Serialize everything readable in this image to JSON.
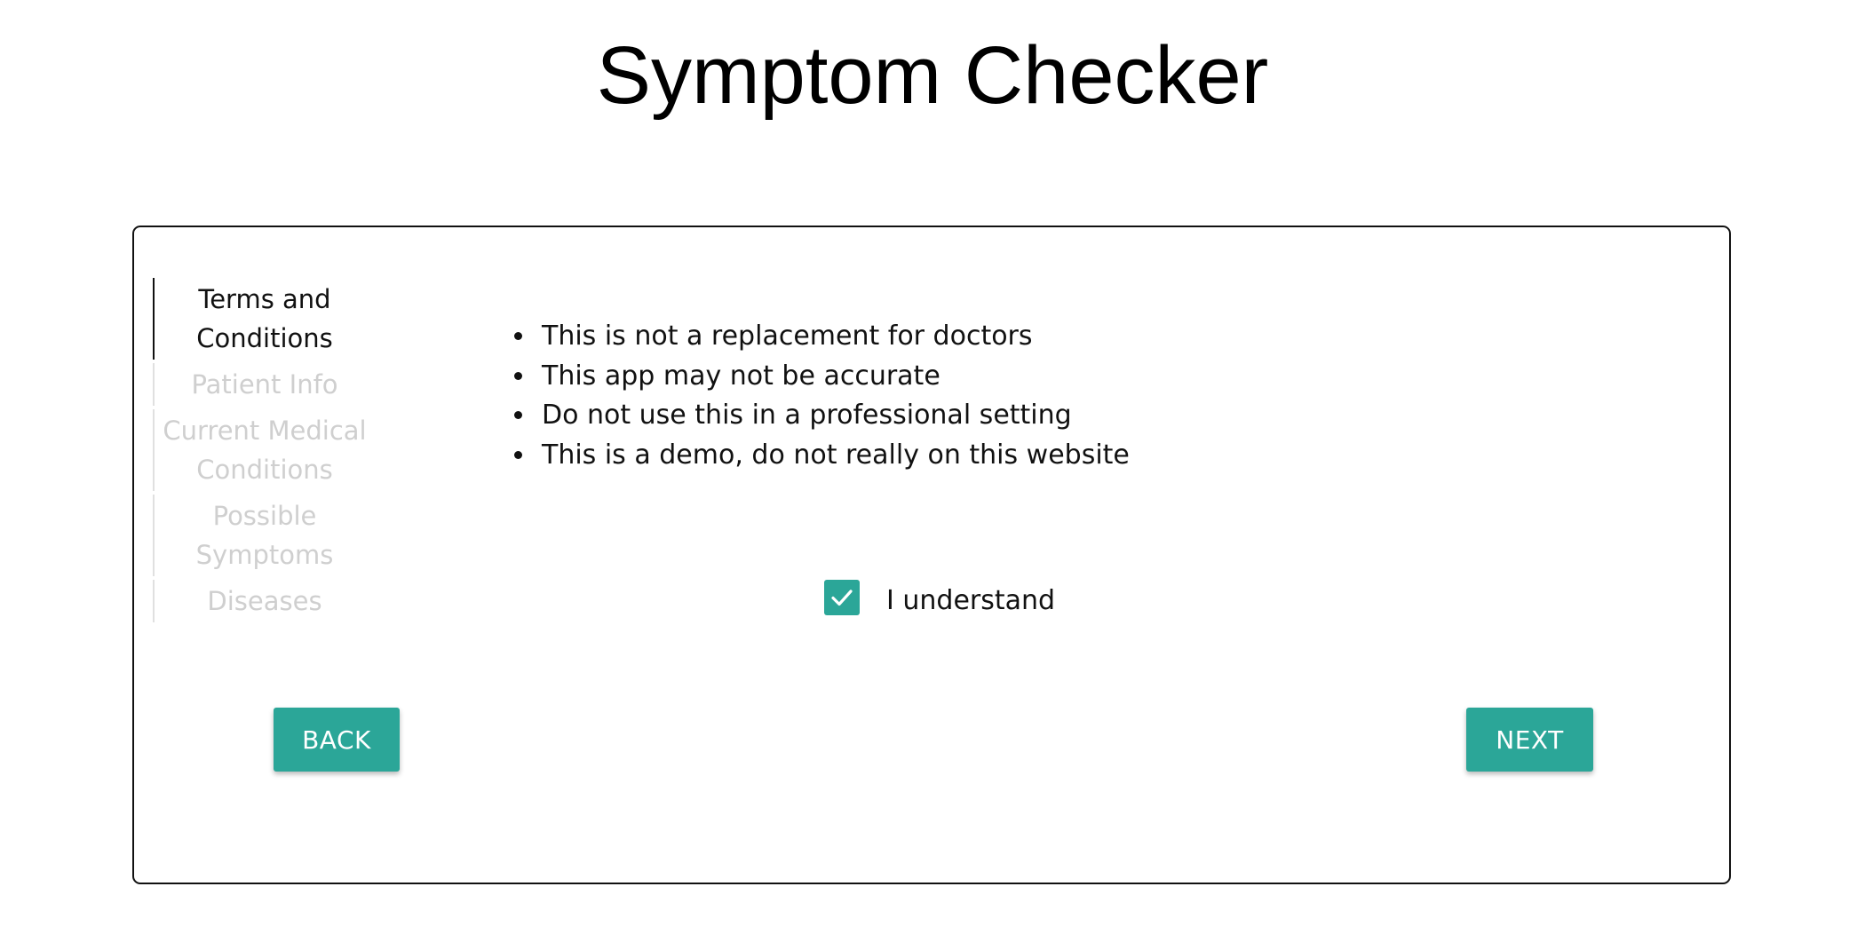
{
  "header": {
    "title": "Symptom Checker"
  },
  "stepper": {
    "steps": [
      {
        "line1": "Terms and",
        "line2": "Conditions",
        "state": "active"
      },
      {
        "line1": "Patient Info",
        "line2": "",
        "state": "inactive"
      },
      {
        "line1": "Current Medical",
        "line2": "Conditions",
        "state": "inactive"
      },
      {
        "line1": "Possible",
        "line2": "Symptoms",
        "state": "inactive"
      },
      {
        "line1": "Diseases",
        "line2": "",
        "state": "inactive"
      }
    ]
  },
  "terms": {
    "items": [
      "This is not a replacement for doctors",
      "This app may not be accurate",
      "Do not use this in a professional setting",
      "This is a demo, do not really on this website"
    ]
  },
  "acknowledge": {
    "label": "I understand",
    "checked": true,
    "icon": "check-icon"
  },
  "buttons": {
    "back_label": "BACK",
    "next_label": "NEXT"
  },
  "colors": {
    "accent": "#2ba698",
    "inactive_text": "#cfcfcf",
    "border": "#111111"
  }
}
